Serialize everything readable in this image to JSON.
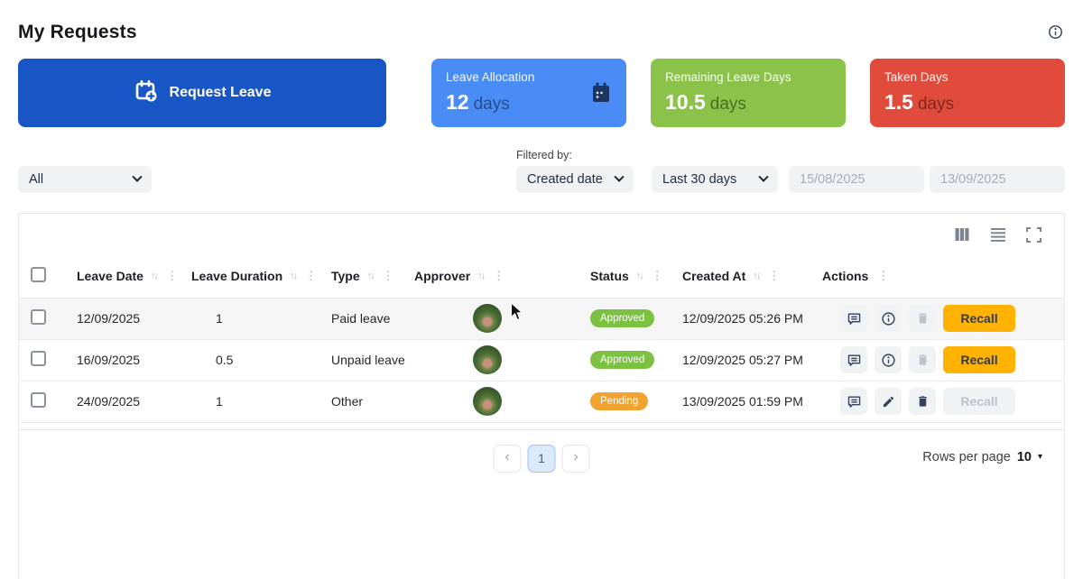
{
  "page": {
    "title": "My Requests"
  },
  "actions_bar": {
    "request_leave_label": "Request Leave"
  },
  "stats": [
    {
      "label": "Leave Allocation",
      "value": "12",
      "unit": "days",
      "color": "#4a8cf5"
    },
    {
      "label": "Remaining Leave Days",
      "value": "10.5",
      "unit": "days",
      "color": "#8bc34a"
    },
    {
      "label": "Taken Days",
      "value": "1.5",
      "unit": "days",
      "color": "#e14b3b"
    }
  ],
  "filters": {
    "type_filter_value": "All",
    "filtered_by_label": "Filtered by:",
    "field_filter_value": "Created date",
    "range_filter_value": "Last 30 days",
    "date_from_placeholder": "15/08/2025",
    "date_to_placeholder": "13/09/2025"
  },
  "table": {
    "columns": [
      "Leave Date",
      "Leave Duration",
      "Type",
      "Approver",
      "Status",
      "Created At",
      "Actions"
    ],
    "rows": [
      {
        "leave_date": "12/09/2025",
        "duration": "1",
        "type": "Paid leave",
        "status": "Approved",
        "status_key": "approved",
        "created_at": "12/09/2025 05:26 PM",
        "recall_label": "Recall"
      },
      {
        "leave_date": "16/09/2025",
        "duration": "0.5",
        "type": "Unpaid leave",
        "status": "Approved",
        "status_key": "approved",
        "created_at": "12/09/2025 05:27 PM",
        "recall_label": "Recall"
      },
      {
        "leave_date": "24/09/2025",
        "duration": "1",
        "type": "Other",
        "status": "Pending",
        "status_key": "pending",
        "created_at": "13/09/2025 01:59 PM",
        "recall_label": "Recall"
      }
    ]
  },
  "pagination": {
    "prev": "‹",
    "current_page": "1",
    "next": "›",
    "rows_per_page_label": "Rows per page",
    "rows_per_page_value": "10",
    "caret": "▾"
  },
  "icons": {
    "sort": "↑↓",
    "menu_dots": "⋮"
  },
  "colors": {
    "primary_button": "#1956c5",
    "card_blue": "#4a8cf5",
    "card_green": "#8bc34a",
    "card_red": "#e14b3b",
    "recall": "#ffb300",
    "badge_approved": "#7cc142",
    "badge_pending": "#f0a32f"
  }
}
